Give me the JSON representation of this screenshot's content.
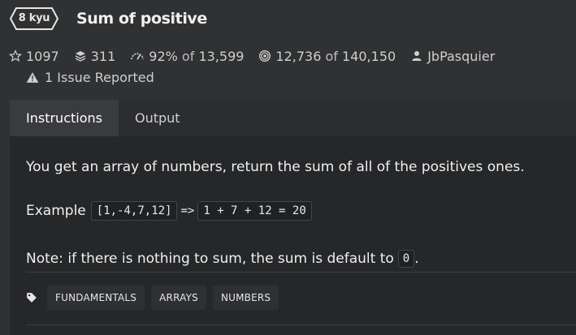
{
  "kata": {
    "rank": "8 kyu",
    "title": "Sum of positive"
  },
  "stats": {
    "stars": "1097",
    "collections": "311",
    "satisfaction": "92%",
    "satisfaction_of": "of",
    "satisfaction_total": "13,599",
    "completed": "12,736",
    "completed_of": "of",
    "completed_total": "140,150",
    "author": "JbPasquier",
    "issues": "1 Issue Reported"
  },
  "tabs": [
    {
      "label": "Instructions",
      "active": true
    },
    {
      "label": "Output",
      "active": false
    }
  ],
  "description": {
    "intro": "You get an array of numbers, return the sum of all of the positives ones.",
    "example_label": "Example",
    "example_input": "[1,-4,7,12]",
    "example_arrow": "=>",
    "example_output": "1 + 7 + 12 = 20",
    "note_prefix": "Note: if there is nothing to sum, the sum is default to",
    "note_code": "0",
    "note_suffix": "."
  },
  "tags": [
    "FUNDAMENTALS",
    "ARRAYS",
    "NUMBERS"
  ],
  "icons": {
    "star": "star-icon",
    "collections": "stack-icon",
    "satisfaction": "gauge-icon",
    "completed": "target-icon",
    "author": "user-icon",
    "issue": "warning-icon",
    "tag": "tag-icon"
  },
  "colors": {
    "background": "#303133",
    "panel": "#262729",
    "active_tab": "#3a3b3e",
    "text": "#f0f0f0"
  }
}
